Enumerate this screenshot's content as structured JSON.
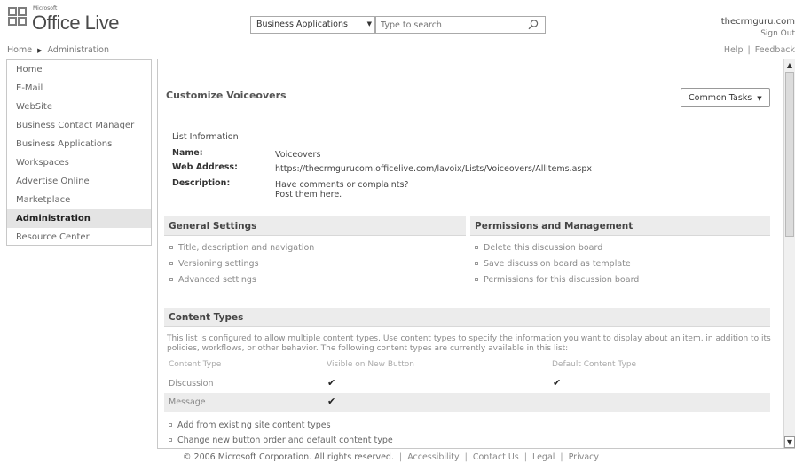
{
  "header": {
    "logo_small": "Microsoft",
    "logo_text": "Office Live",
    "breadcrumb": {
      "home": "Home",
      "current": "Administration"
    },
    "app_select": "Business Applications",
    "search_placeholder": "Type to search",
    "user": "thecrmguru.com",
    "sign_out": "Sign Out",
    "help": "Help",
    "feedback": "Feedback"
  },
  "sidebar": {
    "items": [
      {
        "label": "Home"
      },
      {
        "label": "E-Mail"
      },
      {
        "label": "WebSite"
      },
      {
        "label": "Business Contact Manager"
      },
      {
        "label": "Business Applications"
      },
      {
        "label": "Workspaces"
      },
      {
        "label": "Advertise Online"
      },
      {
        "label": "Marketplace"
      },
      {
        "label": "Administration",
        "active": true
      },
      {
        "label": "Resource Center"
      }
    ]
  },
  "main": {
    "title": "Customize Voiceovers",
    "common_tasks": "Common Tasks",
    "list_info": {
      "heading": "List Information",
      "name_label": "Name:",
      "name_value": "Voiceovers",
      "web_label": "Web Address:",
      "web_value": "https://thecrmgurucom.officelive.com/lavoix/Lists/Voiceovers/AllItems.aspx",
      "desc_label": "Description:",
      "desc_line1": "Have comments or complaints?",
      "desc_line2": "Post them here."
    },
    "general_settings": {
      "heading": "General Settings",
      "links": [
        "Title, description and navigation",
        "Versioning settings",
        "Advanced settings"
      ]
    },
    "permissions": {
      "heading": "Permissions and Management",
      "links": [
        "Delete this discussion board",
        "Save discussion board as template",
        "Permissions for this discussion board"
      ]
    },
    "content_types": {
      "heading": "Content Types",
      "description": "This list is configured to allow multiple content types. Use content types to specify the information you want to display about an item, in addition to its policies, workflows, or other behavior. The following content types are currently available in this list:",
      "columns": [
        "Content Type",
        "Visible on New Button",
        "Default Content Type"
      ],
      "rows": [
        {
          "name": "Discussion",
          "visible": true,
          "default": true
        },
        {
          "name": "Message",
          "visible": true,
          "default": false
        }
      ],
      "links": [
        "Add from existing site content types",
        "Change new button order and default content type"
      ]
    }
  },
  "footer": {
    "copyright": "© 2006 Microsoft Corporation. All rights reserved.",
    "links": [
      "Accessibility",
      "Contact Us",
      "Legal",
      "Privacy"
    ]
  }
}
